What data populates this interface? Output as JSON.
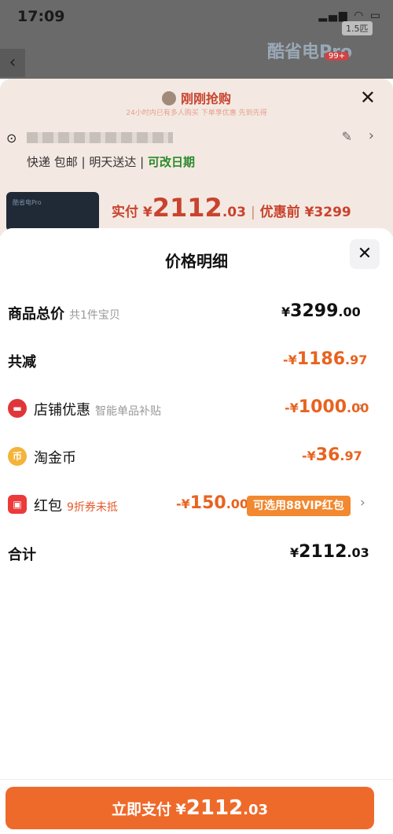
{
  "status_bar": {
    "time": "17:09",
    "icons": "▂▄▆ ◠ ▭"
  },
  "background": {
    "banner_text": "酷省电Pro",
    "badge_top": "1.5匹",
    "badge_cart": "99+",
    "back_glyph": "‹",
    "flash_title": "刚刚抢购",
    "flash_subtitle": "24小时内已有多人购买 下单享优惠 先到先得",
    "close_glyph": "✕",
    "address_masked": "",
    "delivery_text": "快递 包邮 | 明天送达",
    "delivery_change": "可改日期",
    "pay_label": "实付 ¥",
    "pay_int": "2112",
    "pay_dec": ".03",
    "before_discount": "优惠前 ¥3299",
    "product_thumb_text": "酷省电Pro"
  },
  "sheet": {
    "title": "价格明细",
    "close_glyph": "✕",
    "rows": [
      {
        "label": "商品总价",
        "hint": "共1件宝贝",
        "yen": "¥",
        "int": "3299",
        "dec": ".00"
      },
      {
        "label": "共减",
        "yen": "-¥",
        "int": "1186",
        "dec": ".97"
      },
      {
        "label": "店铺优惠",
        "hint": "智能单品补贴",
        "yen": "-¥",
        "int": "1000",
        "dec": ".00",
        "icon": "shop-icon"
      },
      {
        "label": "淘金币",
        "yen": "-¥",
        "int": "36",
        "dec": ".97",
        "icon": "coin-icon",
        "icon_glyph": "币"
      },
      {
        "label": "红包",
        "hint": "9折券未抵",
        "yen": "-¥",
        "int": "150",
        "dec": ".00",
        "icon": "red-packet-icon",
        "badge": "可选用88VIP红包"
      },
      {
        "label": "合计",
        "yen": "¥",
        "int": "2112",
        "dec": ".03"
      }
    ],
    "chevron": "›"
  },
  "footer": {
    "pay_button_text": "立即支付",
    "pay_yen": "¥",
    "pay_int": "2112",
    "pay_dec": ".03"
  },
  "colors": {
    "accent": "#ee6a2b",
    "discount": "#e8631f",
    "brand_red": "#e0363a"
  }
}
